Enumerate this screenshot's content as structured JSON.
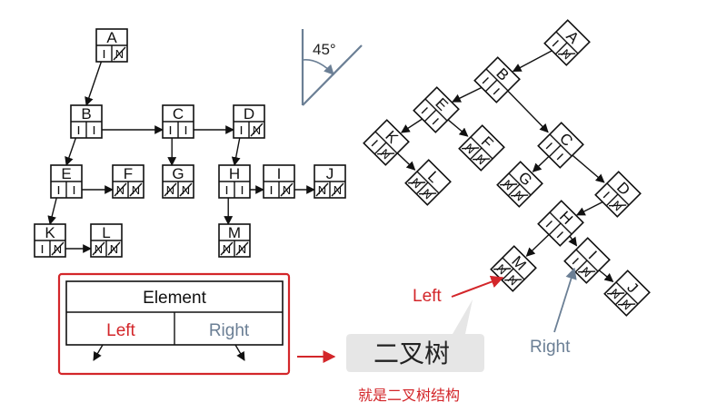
{
  "left_tree": {
    "nodes": [
      {
        "id": "A",
        "label": "A",
        "ptr": "N"
      },
      {
        "id": "B",
        "label": "B",
        "ptr": ""
      },
      {
        "id": "C",
        "label": "C",
        "ptr": ""
      },
      {
        "id": "D",
        "label": "D",
        "ptr": "N"
      },
      {
        "id": "E",
        "label": "E",
        "ptr": ""
      },
      {
        "id": "F",
        "label": "F",
        "ptr": "NN"
      },
      {
        "id": "G",
        "label": "G",
        "ptr": "NN"
      },
      {
        "id": "H",
        "label": "H",
        "ptr": ""
      },
      {
        "id": "I",
        "label": "I",
        "ptr": "N"
      },
      {
        "id": "J",
        "label": "J",
        "ptr": "NN"
      },
      {
        "id": "K",
        "label": "K",
        "ptr": "N"
      },
      {
        "id": "L",
        "label": "L",
        "ptr": "NN"
      },
      {
        "id": "M",
        "label": "M",
        "ptr": "NN"
      }
    ],
    "edges": [
      [
        "A",
        "B"
      ],
      [
        "B",
        "C"
      ],
      [
        "C",
        "D"
      ],
      [
        "B",
        "E"
      ],
      [
        "C",
        "G"
      ],
      [
        "D",
        "H"
      ],
      [
        "E",
        "F"
      ],
      [
        "H",
        "I"
      ],
      [
        "I",
        "J"
      ],
      [
        "E",
        "K"
      ],
      [
        "K",
        "L"
      ],
      [
        "H",
        "M"
      ]
    ]
  },
  "rotation_label": "45°",
  "right_tree": {
    "nodes": [
      {
        "id": "A",
        "label": "A",
        "ptr": "N"
      },
      {
        "id": "B",
        "label": "B",
        "ptr": ""
      },
      {
        "id": "E",
        "label": "E",
        "ptr": ""
      },
      {
        "id": "C",
        "label": "C",
        "ptr": ""
      },
      {
        "id": "K",
        "label": "K",
        "ptr": "N"
      },
      {
        "id": "F",
        "label": "F",
        "ptr": "NN"
      },
      {
        "id": "G",
        "label": "G",
        "ptr": "NN"
      },
      {
        "id": "D",
        "label": "D",
        "ptr": "N"
      },
      {
        "id": "L",
        "label": "L",
        "ptr": "NN"
      },
      {
        "id": "H",
        "label": "H",
        "ptr": ""
      },
      {
        "id": "M",
        "label": "M",
        "ptr": "NN"
      },
      {
        "id": "I",
        "label": "I",
        "ptr": "N"
      },
      {
        "id": "J",
        "label": "J",
        "ptr": "NN"
      }
    ],
    "edges": [
      [
        "A",
        "B"
      ],
      [
        "B",
        "E"
      ],
      [
        "B",
        "C"
      ],
      [
        "E",
        "K"
      ],
      [
        "E",
        "F"
      ],
      [
        "K",
        "L"
      ],
      [
        "C",
        "G"
      ],
      [
        "C",
        "D"
      ],
      [
        "D",
        "H"
      ],
      [
        "H",
        "M"
      ],
      [
        "H",
        "I"
      ],
      [
        "I",
        "J"
      ]
    ],
    "left_annotation": "Left",
    "right_annotation": "Right"
  },
  "legend": {
    "element": "Element",
    "left": "Left",
    "right": "Right"
  },
  "callout": {
    "title": "二叉树",
    "caption": "就是二叉树结构"
  },
  "colors": {
    "red": "#d3262a",
    "slate": "#6b7f95",
    "gray_bubble": "#e6e6e6"
  }
}
